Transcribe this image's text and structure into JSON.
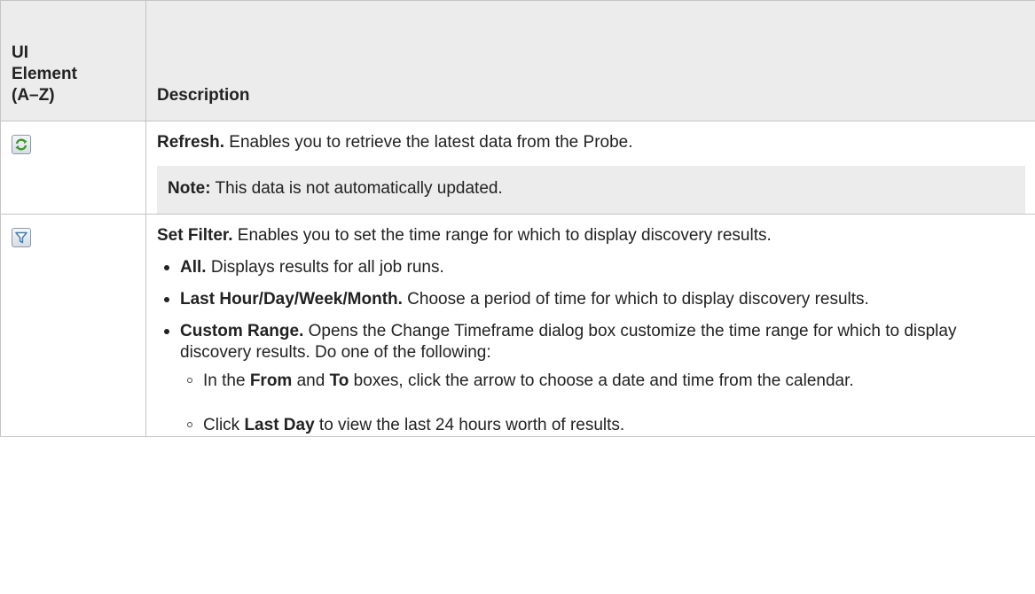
{
  "header": {
    "col1_line1": "UI",
    "col1_line2": "Element",
    "col1_line3": "(A–Z)",
    "col2": "Description"
  },
  "rows": [
    {
      "icon": "refresh-icon",
      "title": "Refresh.",
      "text": " Enables you to retrieve the latest data from the Probe.",
      "note_label": "Note:",
      "note_text": " This data is not automatically updated."
    },
    {
      "icon": "filter-icon",
      "title": "Set Filter.",
      "text": " Enables you to set the time range for which to display discovery results.",
      "bullets": [
        {
          "bold": "All.",
          "text": " Displays results for all job runs."
        },
        {
          "bold": "Last Hour/Day/Week/Month.",
          "text": " Choose a period of time for which to display discovery results."
        },
        {
          "bold": "Custom Range.",
          "text": " Opens the Change Timeframe dialog box customize the time range for which to display discovery results. Do one of the following:"
        }
      ],
      "sub_bullets": [
        {
          "pre": "In the ",
          "bold1": "From",
          "mid": " and ",
          "bold2": "To",
          "post": " boxes, click the arrow to choose a date and time from the calendar."
        },
        {
          "pre": "Click ",
          "bold1": "Last Day",
          "post": " to view the last 24 hours worth of results."
        }
      ]
    }
  ],
  "colors": {
    "header_bg": "#ececec",
    "border": "#c4c4c4",
    "refresh_green": "#3a9a2a",
    "filter_blue": "#4a7fb0"
  }
}
